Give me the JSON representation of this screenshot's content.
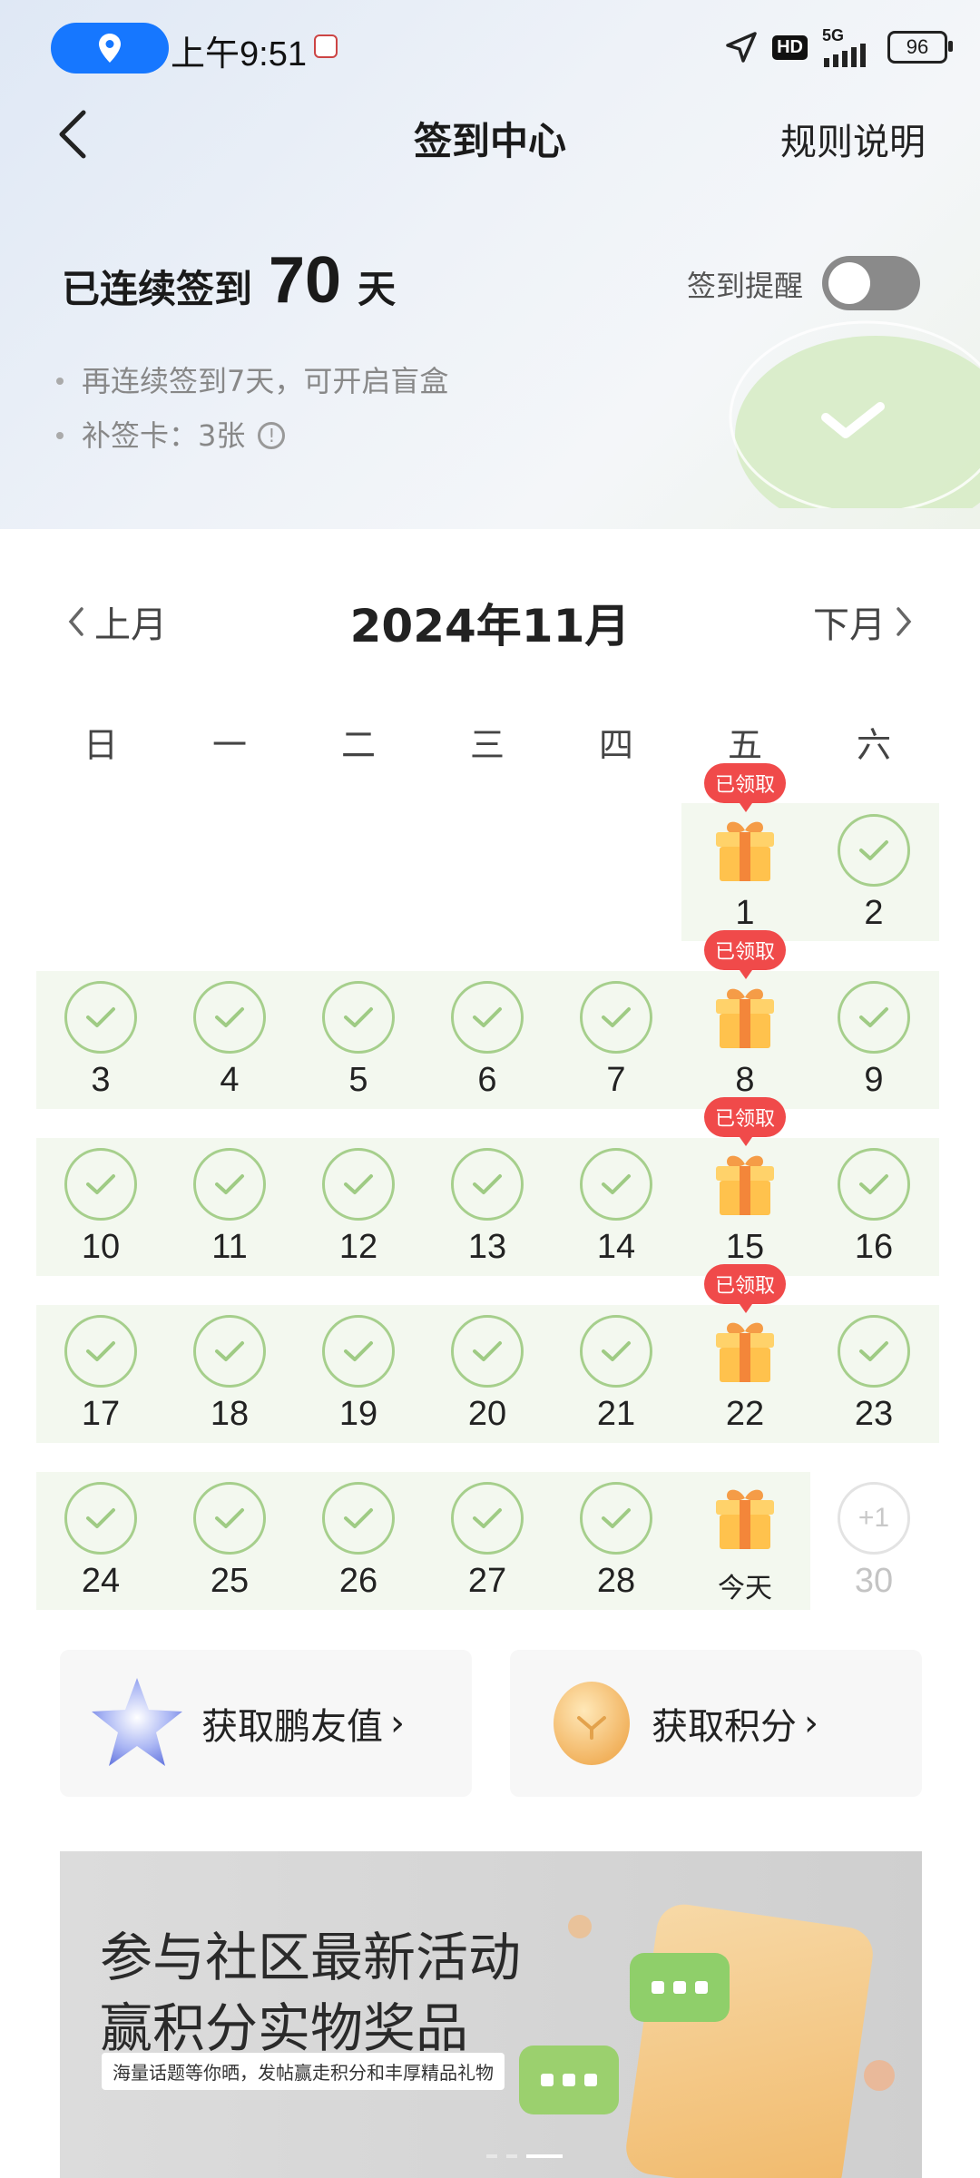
{
  "status_bar": {
    "time": "上午9:51",
    "hd": "HD",
    "network": "5G",
    "battery": "96"
  },
  "nav": {
    "title": "签到中心",
    "rules": "规则说明"
  },
  "streak": {
    "prefix": "已连续签到",
    "days": "70",
    "suffix": "天"
  },
  "reminder": {
    "label": "签到提醒",
    "enabled": false
  },
  "tips": [
    "再连续签到7天，可开启盲盒",
    "补签卡：3张"
  ],
  "calendar": {
    "prev": "上月",
    "month": "2024年11月",
    "next": "下月",
    "weekdays": [
      "日",
      "一",
      "二",
      "三",
      "四",
      "五",
      "六"
    ],
    "claimed_badge": "已领取",
    "today_label": "今天",
    "plus_label": "+1",
    "last_day": "30",
    "days": [
      "1",
      "2",
      "3",
      "4",
      "5",
      "6",
      "7",
      "8",
      "9",
      "10",
      "11",
      "12",
      "13",
      "14",
      "15",
      "16",
      "17",
      "18",
      "19",
      "20",
      "21",
      "22",
      "23",
      "24",
      "25",
      "26",
      "27",
      "28"
    ]
  },
  "cards": [
    {
      "label": "获取鹏友值",
      "icon": "star-icon"
    },
    {
      "label": "获取积分",
      "icon": "coin-icon"
    }
  ],
  "banner": {
    "title_line1": "参与社区最新活动",
    "title_line2": "赢积分实物奖品",
    "subtitle": "海量话题等你晒，发帖赢走积分和丰厚精品礼物"
  },
  "colors": {
    "accent": "#1677ff",
    "check": "#a6cf8c",
    "badge": "#f04a4a",
    "row_bg": "#f3f8ef"
  }
}
